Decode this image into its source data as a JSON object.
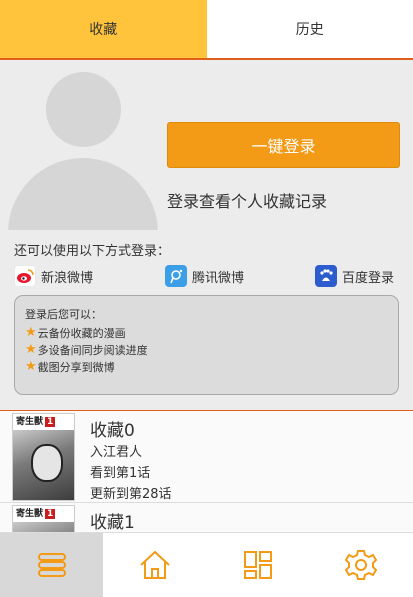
{
  "tabs": [
    {
      "label": "收藏",
      "active": true
    },
    {
      "label": "历史",
      "active": false
    }
  ],
  "login": {
    "button_label": "一键登录",
    "hint": "登录查看个人收藏记录",
    "alt_title": "还可以使用以下方式登录：",
    "providers": [
      {
        "label": "新浪微博",
        "icon": "weibo-icon"
      },
      {
        "label": "腾讯微博",
        "icon": "tencent-weibo-icon"
      },
      {
        "label": "百度登录",
        "icon": "baidu-icon"
      }
    ],
    "benefits_title": "登录后您可以：",
    "benefits": [
      "云备份收藏的漫画",
      "多设备间同步阅读进度",
      "截图分享到微博"
    ]
  },
  "favorites": [
    {
      "name": "收藏0",
      "author": "入江君人",
      "read": "看到第1话",
      "update": "更新到第28话",
      "cover_title": "寄生獸",
      "cover_vol": "1"
    },
    {
      "name": "收藏1",
      "author": "",
      "read": "",
      "update": "",
      "cover_title": "寄生獸",
      "cover_vol": "1"
    }
  ],
  "bottom_nav": [
    {
      "icon": "menu-icon",
      "active": true
    },
    {
      "icon": "home-icon",
      "active": false
    },
    {
      "icon": "grid-icon",
      "active": false
    },
    {
      "icon": "settings-icon",
      "active": false
    }
  ],
  "colors": {
    "accent_yellow": "#ffc43b",
    "accent_orange": "#f39a16",
    "divider": "#e25f1b",
    "nav_icon": "#f39a16"
  }
}
